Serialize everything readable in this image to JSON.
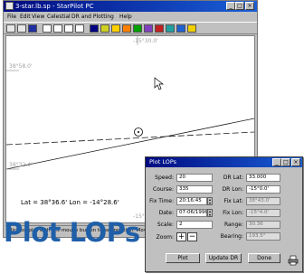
{
  "window": {
    "title": "3-star.lb.sp - StarPilot PC"
  },
  "menu": [
    "File",
    "Edit",
    "View",
    "Celestial",
    "DR and Plotting",
    "Help"
  ],
  "toolbar": {
    "tools": [
      "new-icon",
      "open-icon",
      "save-icon",
      "cut-icon",
      "copy-icon",
      "paste-icon",
      "print-icon",
      "plot-icon",
      "sun-icon",
      "moon-icon",
      "planet-icon",
      "star-icon",
      "lop-icon",
      "fix-icon",
      "grid-icon",
      "globe-icon",
      "help-icon"
    ],
    "colors": [
      "#e8e8e8",
      "#e8e8e8",
      "#2030a0",
      "#ffffff",
      "#ffffff",
      "#ffffff",
      "#ffffff",
      "#000080",
      "#d0d020",
      "#ffd000",
      "#ff8000",
      "#00a000",
      "#8040c0",
      "#c02020",
      "#20a0a0",
      "#2060d0",
      "#f0d000"
    ]
  },
  "chart": {
    "coords": {
      "top": "-15°30.0'",
      "upper_left": "38°58.0'",
      "lower_left": "38°32.4'",
      "bottom_center": "-15°30.0'"
    },
    "position_readout": "Lat = 38°36.6'   Lon = -14°28.6'"
  },
  "status": "Click on plot with left mouse button to set position. Move mouse...",
  "dialog": {
    "title": "Plot LOPs",
    "fields": {
      "speed": {
        "label": "Speed:",
        "value": "20"
      },
      "course": {
        "label": "Course:",
        "value": "335"
      },
      "fix_time": {
        "label": "Fix Time:",
        "value": "20:16:45"
      },
      "date": {
        "label": "Date:",
        "value": "07-06/1996"
      },
      "scale": {
        "label": "Scale:",
        "value": "2"
      },
      "zoom": {
        "label": "Zoom:"
      },
      "dr_lat": {
        "label": "DR Lat:",
        "value": "33.000"
      },
      "dr_lon": {
        "label": "DR Lon:",
        "value": "-15°0.0'"
      },
      "fix_lat": {
        "label": "Fix Lat:",
        "value": "38°43.0'"
      },
      "fix_lon": {
        "label": "Fix Lon:",
        "value": "-15°4.0'"
      },
      "range": {
        "label": "Range:",
        "value": "30.36"
      },
      "bearing": {
        "label": "Bearing:",
        "value": "193.5°"
      }
    },
    "buttons": {
      "plot": "Plot",
      "update_dr": "Update DR",
      "done": "Done"
    }
  },
  "caption": "Plot LOPs"
}
